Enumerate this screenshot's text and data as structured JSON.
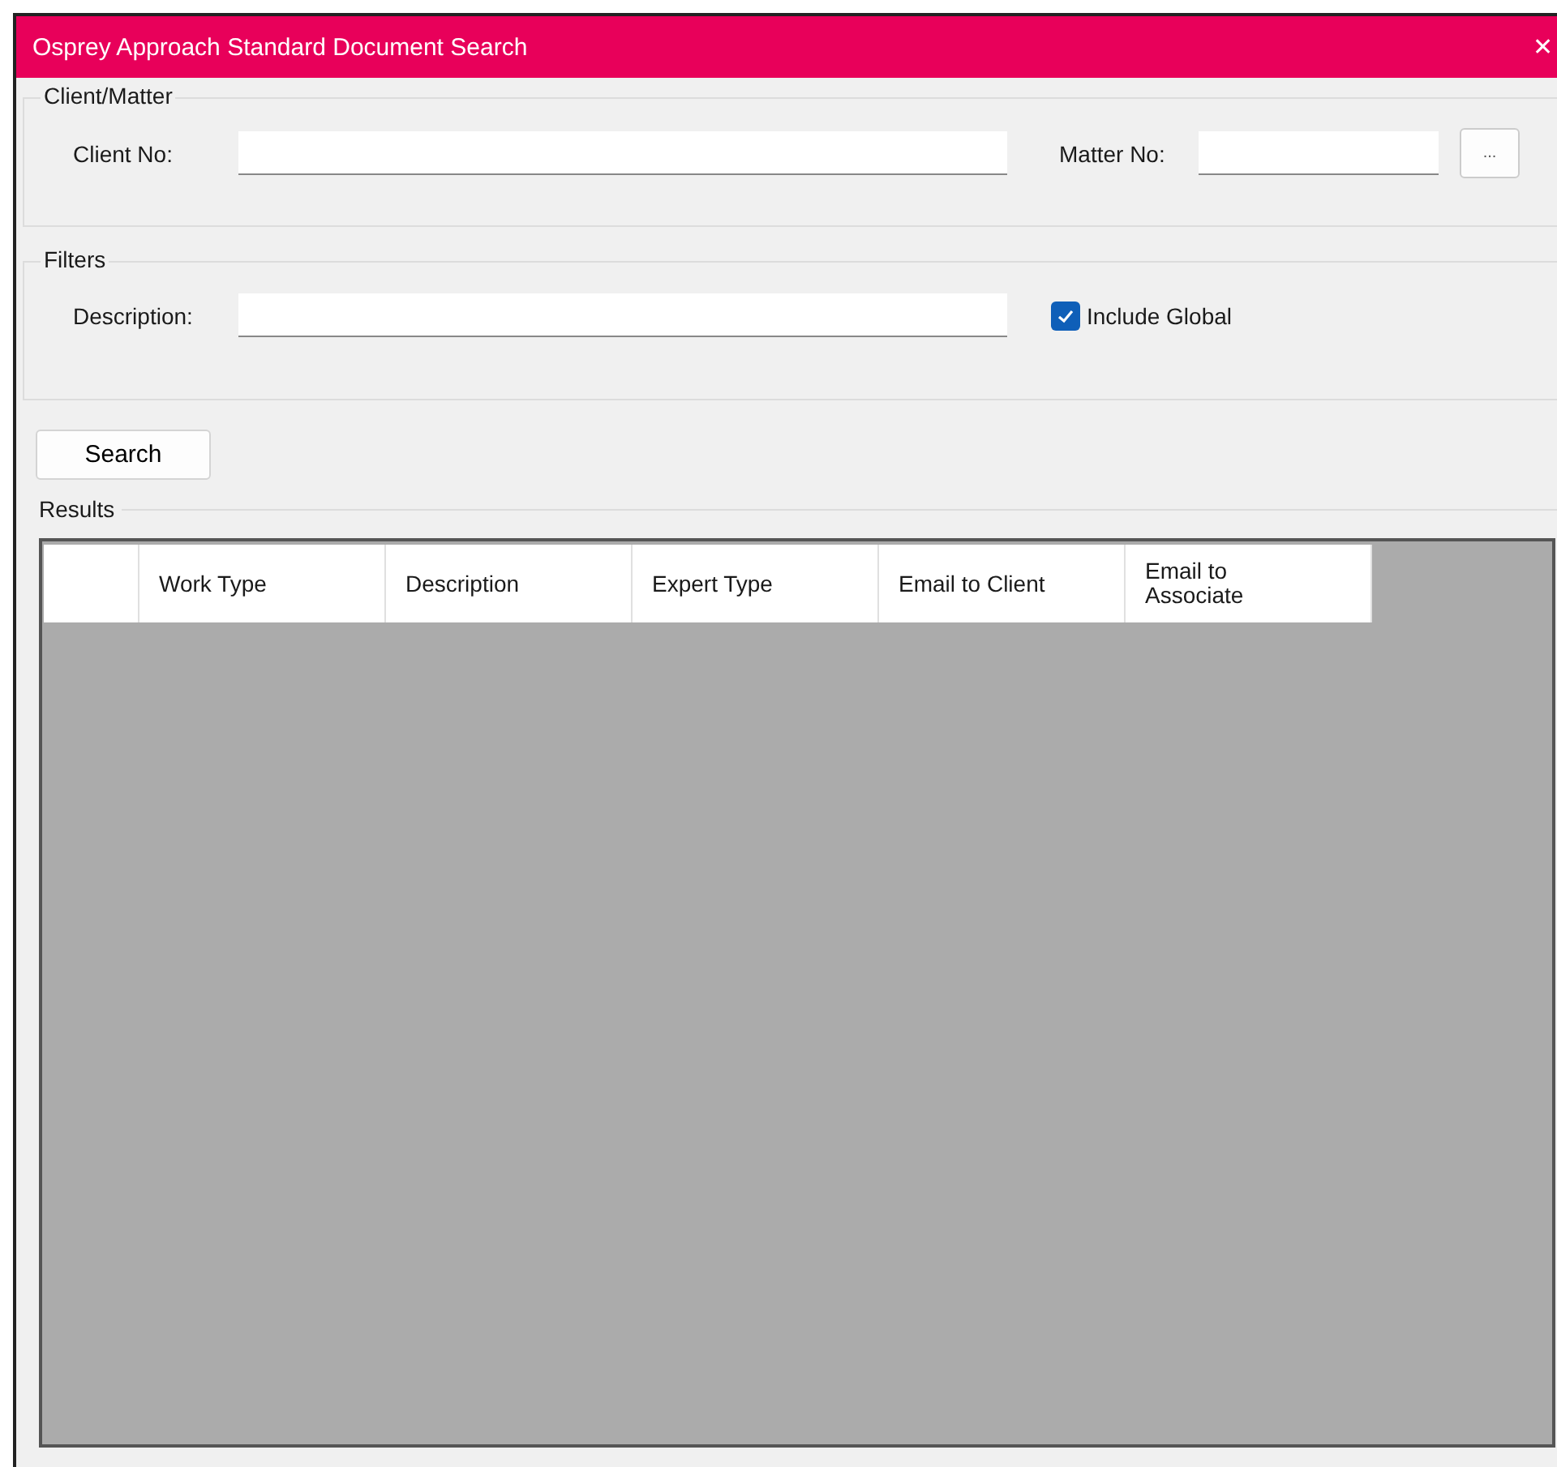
{
  "window": {
    "title": "Osprey Approach Standard Document Search",
    "close": "✕"
  },
  "client_matter": {
    "legend": "Client/Matter",
    "client_label": "Client No:",
    "matter_label": "Matter No:",
    "browse_button": "..."
  },
  "filters": {
    "legend": "Filters",
    "description_label": "Description:",
    "include_global": {
      "label": "Include Global",
      "checked": true
    }
  },
  "search_button": "Search",
  "results": {
    "legend": "Results",
    "columns": [
      "Work Type",
      "Description",
      "Expert Type",
      "Email to Client",
      "Email to\nAssociate"
    ]
  }
}
